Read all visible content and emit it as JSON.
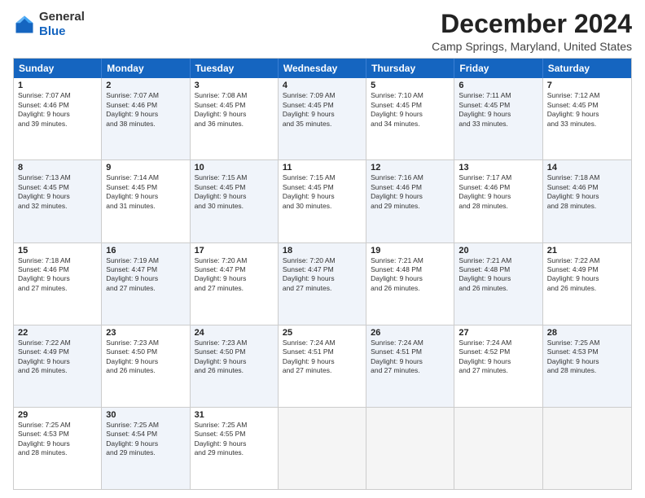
{
  "logo": {
    "general": "General",
    "blue": "Blue"
  },
  "title": "December 2024",
  "location": "Camp Springs, Maryland, United States",
  "headers": [
    "Sunday",
    "Monday",
    "Tuesday",
    "Wednesday",
    "Thursday",
    "Friday",
    "Saturday"
  ],
  "rows": [
    [
      {
        "day": "1",
        "text": "Sunrise: 7:07 AM\nSunset: 4:46 PM\nDaylight: 9 hours\nand 39 minutes.",
        "shaded": false
      },
      {
        "day": "2",
        "text": "Sunrise: 7:07 AM\nSunset: 4:46 PM\nDaylight: 9 hours\nand 38 minutes.",
        "shaded": true
      },
      {
        "day": "3",
        "text": "Sunrise: 7:08 AM\nSunset: 4:45 PM\nDaylight: 9 hours\nand 36 minutes.",
        "shaded": false
      },
      {
        "day": "4",
        "text": "Sunrise: 7:09 AM\nSunset: 4:45 PM\nDaylight: 9 hours\nand 35 minutes.",
        "shaded": true
      },
      {
        "day": "5",
        "text": "Sunrise: 7:10 AM\nSunset: 4:45 PM\nDaylight: 9 hours\nand 34 minutes.",
        "shaded": false
      },
      {
        "day": "6",
        "text": "Sunrise: 7:11 AM\nSunset: 4:45 PM\nDaylight: 9 hours\nand 33 minutes.",
        "shaded": true
      },
      {
        "day": "7",
        "text": "Sunrise: 7:12 AM\nSunset: 4:45 PM\nDaylight: 9 hours\nand 33 minutes.",
        "shaded": false
      }
    ],
    [
      {
        "day": "8",
        "text": "Sunrise: 7:13 AM\nSunset: 4:45 PM\nDaylight: 9 hours\nand 32 minutes.",
        "shaded": true
      },
      {
        "day": "9",
        "text": "Sunrise: 7:14 AM\nSunset: 4:45 PM\nDaylight: 9 hours\nand 31 minutes.",
        "shaded": false
      },
      {
        "day": "10",
        "text": "Sunrise: 7:15 AM\nSunset: 4:45 PM\nDaylight: 9 hours\nand 30 minutes.",
        "shaded": true
      },
      {
        "day": "11",
        "text": "Sunrise: 7:15 AM\nSunset: 4:45 PM\nDaylight: 9 hours\nand 30 minutes.",
        "shaded": false
      },
      {
        "day": "12",
        "text": "Sunrise: 7:16 AM\nSunset: 4:46 PM\nDaylight: 9 hours\nand 29 minutes.",
        "shaded": true
      },
      {
        "day": "13",
        "text": "Sunrise: 7:17 AM\nSunset: 4:46 PM\nDaylight: 9 hours\nand 28 minutes.",
        "shaded": false
      },
      {
        "day": "14",
        "text": "Sunrise: 7:18 AM\nSunset: 4:46 PM\nDaylight: 9 hours\nand 28 minutes.",
        "shaded": true
      }
    ],
    [
      {
        "day": "15",
        "text": "Sunrise: 7:18 AM\nSunset: 4:46 PM\nDaylight: 9 hours\nand 27 minutes.",
        "shaded": false
      },
      {
        "day": "16",
        "text": "Sunrise: 7:19 AM\nSunset: 4:47 PM\nDaylight: 9 hours\nand 27 minutes.",
        "shaded": true
      },
      {
        "day": "17",
        "text": "Sunrise: 7:20 AM\nSunset: 4:47 PM\nDaylight: 9 hours\nand 27 minutes.",
        "shaded": false
      },
      {
        "day": "18",
        "text": "Sunrise: 7:20 AM\nSunset: 4:47 PM\nDaylight: 9 hours\nand 27 minutes.",
        "shaded": true
      },
      {
        "day": "19",
        "text": "Sunrise: 7:21 AM\nSunset: 4:48 PM\nDaylight: 9 hours\nand 26 minutes.",
        "shaded": false
      },
      {
        "day": "20",
        "text": "Sunrise: 7:21 AM\nSunset: 4:48 PM\nDaylight: 9 hours\nand 26 minutes.",
        "shaded": true
      },
      {
        "day": "21",
        "text": "Sunrise: 7:22 AM\nSunset: 4:49 PM\nDaylight: 9 hours\nand 26 minutes.",
        "shaded": false
      }
    ],
    [
      {
        "day": "22",
        "text": "Sunrise: 7:22 AM\nSunset: 4:49 PM\nDaylight: 9 hours\nand 26 minutes.",
        "shaded": true
      },
      {
        "day": "23",
        "text": "Sunrise: 7:23 AM\nSunset: 4:50 PM\nDaylight: 9 hours\nand 26 minutes.",
        "shaded": false
      },
      {
        "day": "24",
        "text": "Sunrise: 7:23 AM\nSunset: 4:50 PM\nDaylight: 9 hours\nand 26 minutes.",
        "shaded": true
      },
      {
        "day": "25",
        "text": "Sunrise: 7:24 AM\nSunset: 4:51 PM\nDaylight: 9 hours\nand 27 minutes.",
        "shaded": false
      },
      {
        "day": "26",
        "text": "Sunrise: 7:24 AM\nSunset: 4:51 PM\nDaylight: 9 hours\nand 27 minutes.",
        "shaded": true
      },
      {
        "day": "27",
        "text": "Sunrise: 7:24 AM\nSunset: 4:52 PM\nDaylight: 9 hours\nand 27 minutes.",
        "shaded": false
      },
      {
        "day": "28",
        "text": "Sunrise: 7:25 AM\nSunset: 4:53 PM\nDaylight: 9 hours\nand 28 minutes.",
        "shaded": true
      }
    ],
    [
      {
        "day": "29",
        "text": "Sunrise: 7:25 AM\nSunset: 4:53 PM\nDaylight: 9 hours\nand 28 minutes.",
        "shaded": false
      },
      {
        "day": "30",
        "text": "Sunrise: 7:25 AM\nSunset: 4:54 PM\nDaylight: 9 hours\nand 29 minutes.",
        "shaded": true
      },
      {
        "day": "31",
        "text": "Sunrise: 7:25 AM\nSunset: 4:55 PM\nDaylight: 9 hours\nand 29 minutes.",
        "shaded": false
      },
      {
        "day": "",
        "text": "",
        "shaded": true,
        "empty": true
      },
      {
        "day": "",
        "text": "",
        "shaded": true,
        "empty": true
      },
      {
        "day": "",
        "text": "",
        "shaded": true,
        "empty": true
      },
      {
        "day": "",
        "text": "",
        "shaded": true,
        "empty": true
      }
    ]
  ]
}
